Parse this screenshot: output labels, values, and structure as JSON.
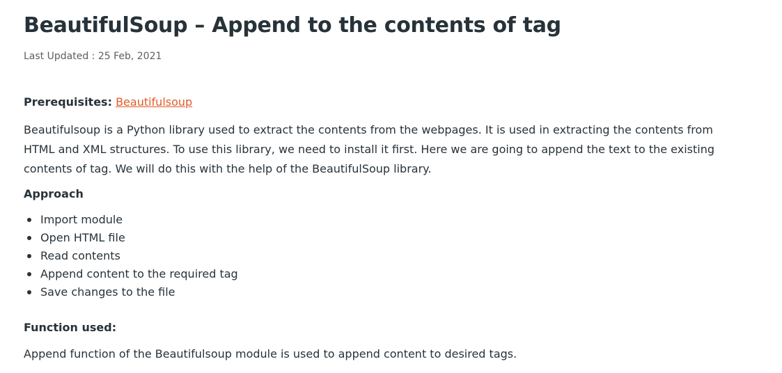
{
  "article": {
    "title": "BeautifulSoup – Append to the contents of tag",
    "last_updated": "Last Updated : 25 Feb, 2021",
    "prerequisites_label": "Prerequisites:",
    "prerequisites_link": "Beautifulsoup",
    "intro": "Beautifulsoup is a Python library used to extract the contents from the webpages. It is used in extracting the contents from HTML and XML structures. To use this library, we need to install it first. Here we are going to append the text to the existing contents of tag. We will do this with the help of the BeautifulSoup library.",
    "approach_heading": "Approach",
    "approach_steps": [
      "Import module",
      "Open HTML file",
      "Read contents",
      "Append content to the required tag",
      "Save changes to the file"
    ],
    "function_heading": "Function used:",
    "function_text": "Append function of the Beautifulsoup module is used to append content to desired tags."
  },
  "colors": {
    "text": "#273239",
    "muted": "#5b5f63",
    "link": "#e15b2a"
  }
}
